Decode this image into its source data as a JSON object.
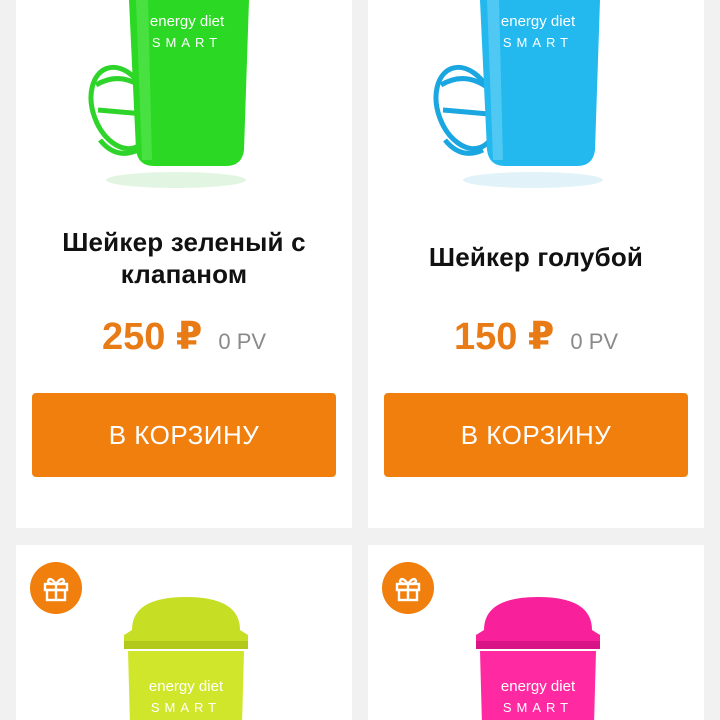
{
  "products": [
    {
      "title": "Шейкер зеленый с клапаном",
      "price": "250 ₽",
      "pv": "0 PV",
      "button": "В КОРЗИНУ",
      "color": "#22d81e",
      "brand": "energy diet",
      "sub": "SMART"
    },
    {
      "title": "Шейкер голубой",
      "price": "150 ₽",
      "pv": "0 PV",
      "button": "В КОРЗИНУ",
      "color": "#1fb6ee",
      "brand": "energy diet",
      "sub": "SMART"
    },
    {
      "brand": "energy diet",
      "sub": "SMART",
      "color": "#c8e023",
      "icon": "gift-icon"
    },
    {
      "brand": "energy diet",
      "sub": "SMART",
      "color": "#ff1f9a",
      "icon": "gift-icon"
    }
  ]
}
